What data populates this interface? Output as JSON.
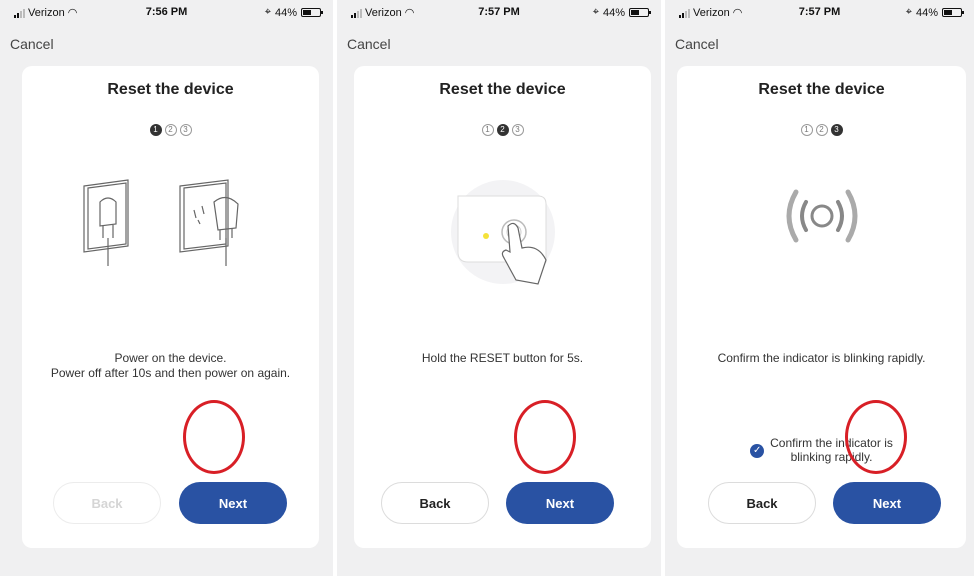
{
  "panels": [
    {
      "status": {
        "carrier": "Verizon",
        "time": "7:56 PM",
        "battery": "44%"
      },
      "cancel": "Cancel",
      "title": "Reset the device",
      "steps": [
        "1",
        "2",
        "3"
      ],
      "active_step": 1,
      "illustration": "plug-icon",
      "description": "Power on the device.\nPower off after 10s and then power on again.",
      "back_label": "Back",
      "back_disabled": true,
      "next_label": "Next"
    },
    {
      "status": {
        "carrier": "Verizon",
        "time": "7:57 PM",
        "battery": "44%"
      },
      "cancel": "Cancel",
      "title": "Reset the device",
      "steps": [
        "1",
        "2",
        "3"
      ],
      "active_step": 2,
      "illustration": "reset-button-icon",
      "description": "Hold the RESET button for 5s.",
      "back_label": "Back",
      "back_disabled": false,
      "next_label": "Next"
    },
    {
      "status": {
        "carrier": "Verizon",
        "time": "7:57 PM",
        "battery": "44%"
      },
      "cancel": "Cancel",
      "title": "Reset the device",
      "steps": [
        "1",
        "2",
        "3"
      ],
      "active_step": 3,
      "illustration": "blinking-indicator-icon",
      "description": "Confirm the indicator is blinking rapidly.",
      "confirm_text": "Confirm the indicator is\nblinking rapidly.",
      "confirm_checked": true,
      "back_label": "Back",
      "back_disabled": false,
      "next_label": "Next"
    }
  ],
  "colors": {
    "accent": "#2952a3",
    "annotation": "#d81f26",
    "background": "#f0f0f1"
  }
}
